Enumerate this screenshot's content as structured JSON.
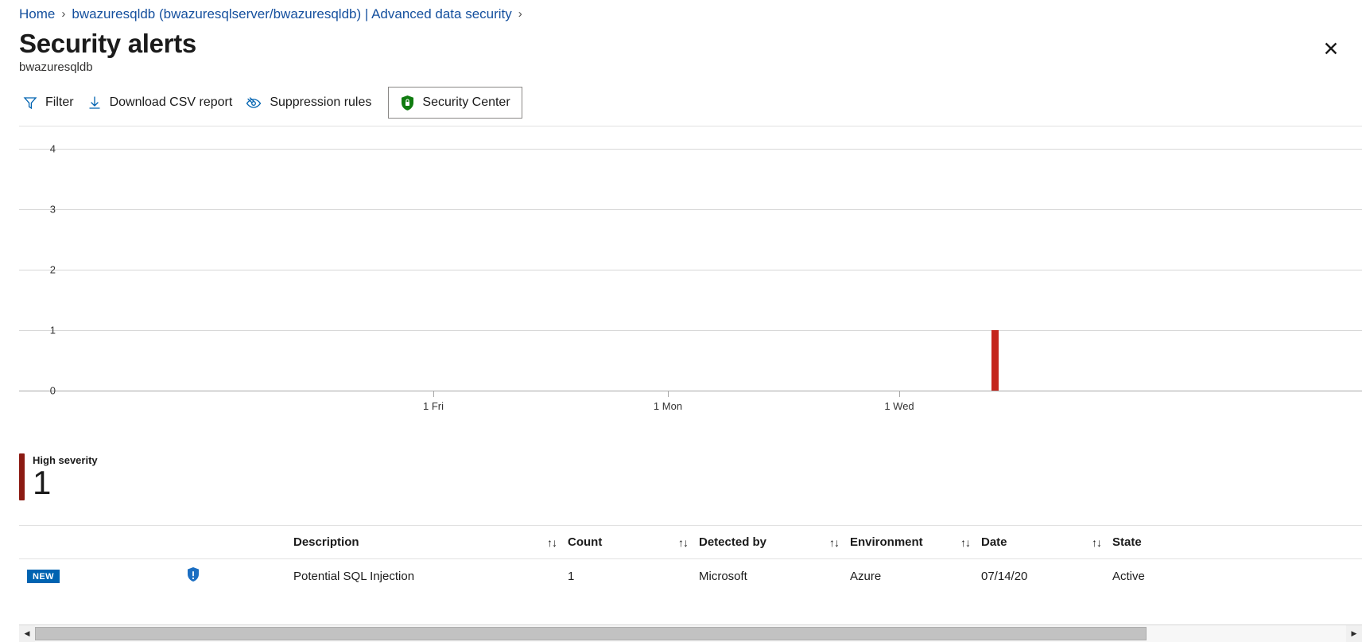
{
  "breadcrumb": {
    "items": [
      {
        "label": "Home"
      },
      {
        "label": "bwazuresqldb (bwazuresqlserver/bwazuresqldb) | Advanced data security"
      }
    ],
    "separator": "›"
  },
  "header": {
    "title": "Security alerts",
    "subtitle": "bwazuresqldb",
    "close_label": "✕"
  },
  "toolbar": {
    "filter_label": "Filter",
    "download_label": "Download CSV report",
    "suppression_label": "Suppression rules",
    "security_center_label": "Security Center"
  },
  "chart_data": {
    "type": "bar",
    "title": "",
    "xlabel": "",
    "ylabel": "",
    "categories": [
      "1 Fri",
      "1 Mon",
      "1 Wed"
    ],
    "x_tick_labels": [
      "1 Fri",
      "1 Mon",
      "1 Wed"
    ],
    "y_tick_labels": [
      "4",
      "3",
      "2",
      "1",
      "0"
    ],
    "ylim": [
      0,
      4.4
    ],
    "grid": true,
    "legend": "none",
    "series": [
      {
        "name": "High severity",
        "color": "#c4261d",
        "points": [
          {
            "x": "07/14",
            "y": 1
          }
        ]
      }
    ],
    "bars": [
      {
        "label": "07/14/20",
        "value": 1,
        "color": "#c4261d",
        "x_fraction": 0.781
      }
    ]
  },
  "severity": {
    "label": "High severity",
    "count": "1",
    "color": "#8b1a12"
  },
  "table": {
    "columns": [
      {
        "key": "badge",
        "label": "",
        "sortable": false
      },
      {
        "key": "icon",
        "label": "",
        "sortable": false
      },
      {
        "key": "description",
        "label": "Description",
        "sortable": true
      },
      {
        "key": "count",
        "label": "Count",
        "sortable": true
      },
      {
        "key": "detected_by",
        "label": "Detected by",
        "sortable": true
      },
      {
        "key": "environment",
        "label": "Environment",
        "sortable": true
      },
      {
        "key": "date",
        "label": "Date",
        "sortable": true
      },
      {
        "key": "state",
        "label": "State",
        "sortable": false
      }
    ],
    "sort_icon": "↑↓",
    "rows": [
      {
        "badge": "NEW",
        "description": "Potential SQL Injection",
        "count": "1",
        "detected_by": "Microsoft",
        "environment": "Azure",
        "date": "07/14/20",
        "state": "Active"
      }
    ]
  },
  "scrollbar": {
    "left_arrow": "◀",
    "right_arrow": "▶"
  },
  "colors": {
    "link": "#15509e",
    "accent": "#0063b1",
    "high_severity": "#c4261d",
    "shield_green": "#0b6a0b",
    "shield_blue": "#1b6ec2"
  }
}
